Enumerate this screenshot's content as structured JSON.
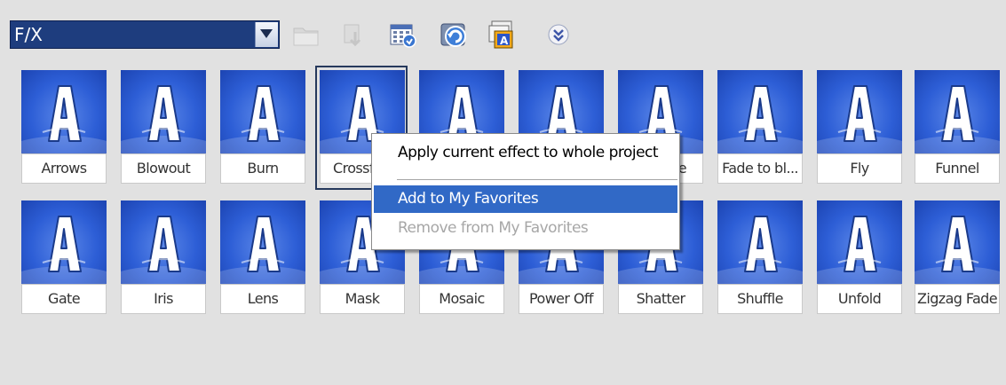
{
  "toolbar": {
    "category_value": "F/X",
    "icons": [
      "folder-icon",
      "import-icon",
      "grid-view-icon",
      "refresh-icon",
      "gallery-icon",
      "more-icon"
    ]
  },
  "effects": [
    {
      "label": "Arrows"
    },
    {
      "label": "Blowout"
    },
    {
      "label": "Burn"
    },
    {
      "label": "Crossfa"
    },
    {
      "label": ""
    },
    {
      "label": ""
    },
    {
      "label": "e"
    },
    {
      "label": "Fade to bl..."
    },
    {
      "label": "Fly"
    },
    {
      "label": "Funnel"
    },
    {
      "label": "Gate"
    },
    {
      "label": "Iris"
    },
    {
      "label": "Lens"
    },
    {
      "label": "Mask"
    },
    {
      "label": "Mosaic"
    },
    {
      "label": "Power Off"
    },
    {
      "label": "Shatter"
    },
    {
      "label": "Shuffle"
    },
    {
      "label": "Unfold"
    },
    {
      "label": "Zigzag Fade"
    }
  ],
  "context_menu": {
    "apply_whole_project": "Apply current effect to whole project",
    "add_favorites": "Add to My Favorites",
    "remove_favorites": "Remove from My Favorites"
  },
  "colors": {
    "accent": "#3169c6",
    "select_bg": "#1e3d7e",
    "tile_blue": "#2d5ed6",
    "panel_bg": "#e1e1e1"
  }
}
